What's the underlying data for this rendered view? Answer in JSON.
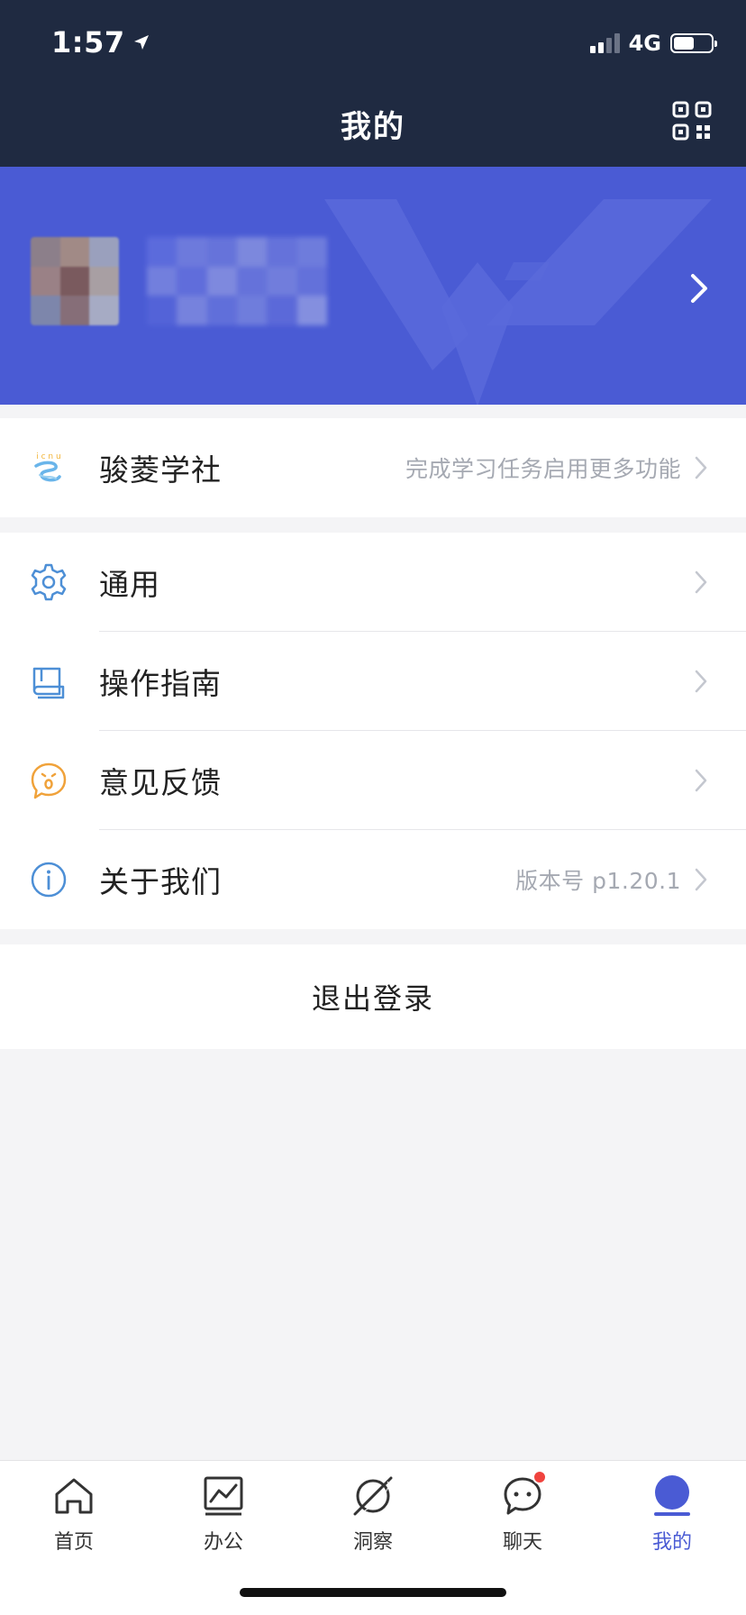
{
  "status_bar": {
    "time": "1:57",
    "network": "4G",
    "battery_level": 0.55,
    "location_icon": "location-arrow-icon"
  },
  "header": {
    "title": "我的",
    "qr_icon": "qr-code-icon"
  },
  "colors": {
    "header_bg": "#1f2a41",
    "banner_bg": "#4a5bd4",
    "accent": "#4a5bd4",
    "badge": "#f0433e",
    "muted_text": "#a5a9b2"
  },
  "profile": {
    "avatar": "blurred-avatar",
    "name": "blurred-name"
  },
  "study": {
    "label": "骏菱学社",
    "value": "完成学习任务启用更多功能",
    "icon": "junling-logo-icon"
  },
  "settings": [
    {
      "label": "通用",
      "icon": "gear-icon",
      "value": ""
    },
    {
      "label": "操作指南",
      "icon": "book-icon",
      "value": ""
    },
    {
      "label": "意见反馈",
      "icon": "feedback-icon",
      "value": ""
    },
    {
      "label": "关于我们",
      "icon": "info-icon",
      "value": "版本号 p1.20.1"
    }
  ],
  "logout_label": "退出登录",
  "tabs": [
    {
      "label": "首页",
      "icon": "home-icon",
      "active": false,
      "badge": false
    },
    {
      "label": "办公",
      "icon": "chart-icon",
      "active": false,
      "badge": false
    },
    {
      "label": "洞察",
      "icon": "planet-icon",
      "active": false,
      "badge": false
    },
    {
      "label": "聊天",
      "icon": "chat-icon",
      "active": false,
      "badge": true
    },
    {
      "label": "我的",
      "icon": "profile-icon",
      "active": true,
      "badge": false
    }
  ]
}
